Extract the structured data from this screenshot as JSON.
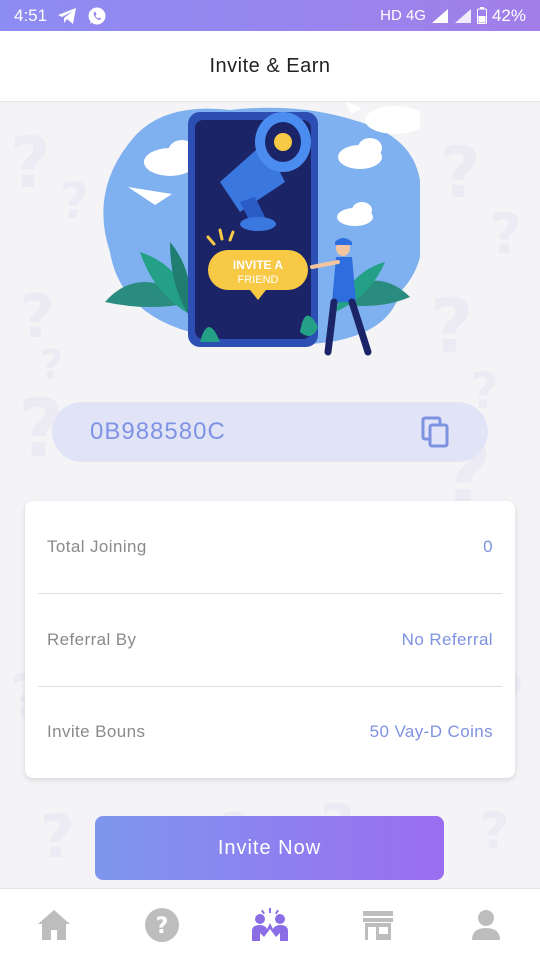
{
  "status_bar": {
    "time": "4:51",
    "network": "HD 4G",
    "battery": "42%"
  },
  "header": {
    "title": "Invite & Earn"
  },
  "hero": {
    "badge_line1": "INVITE A",
    "badge_line2": "FRIEND"
  },
  "referral": {
    "code": "0B988580C"
  },
  "stats": [
    {
      "label": "Total Joining",
      "value": "0"
    },
    {
      "label": "Referral By",
      "value": "No Referral"
    },
    {
      "label": "Invite Bouns",
      "value": "50 Vay-D Coins"
    }
  ],
  "invite_button": {
    "label": "Invite Now"
  },
  "bottom_nav": [
    {
      "icon": "home-icon"
    },
    {
      "icon": "help-icon"
    },
    {
      "icon": "invite-icon",
      "active": true
    },
    {
      "icon": "store-icon"
    },
    {
      "icon": "profile-icon"
    }
  ],
  "colors": {
    "accent": "#7e92e2",
    "active_nav": "#8b6ee6",
    "inactive_nav": "#bdbdbd"
  }
}
